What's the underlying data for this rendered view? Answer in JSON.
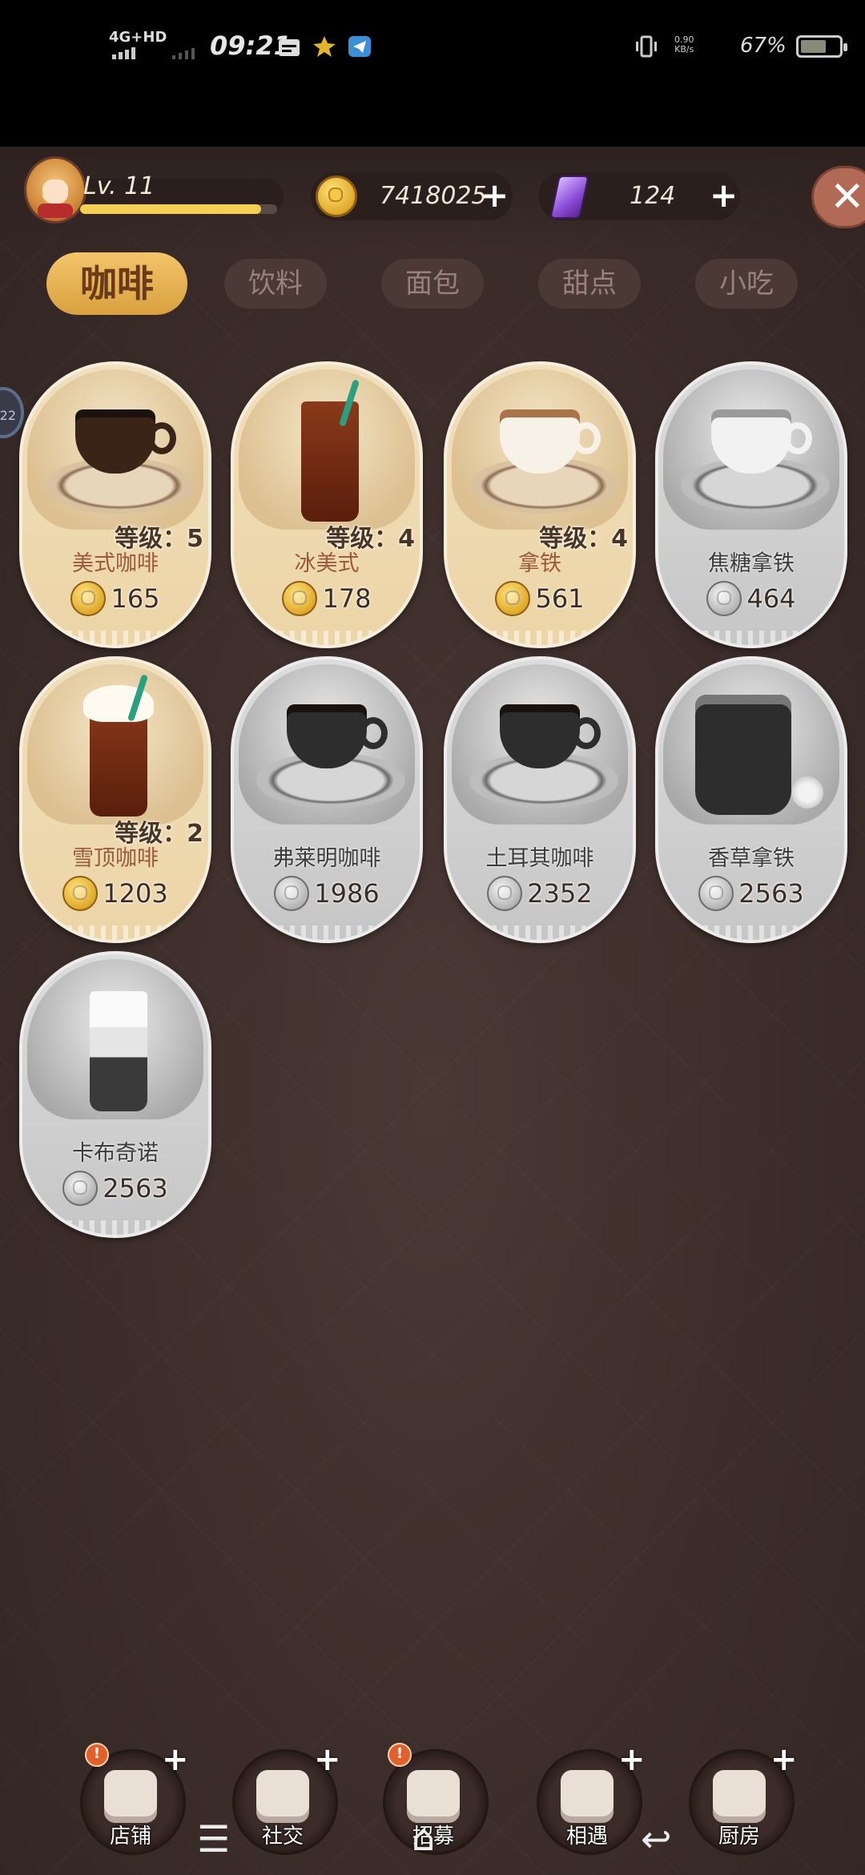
{
  "status_bar": {
    "network": "4G+HD",
    "time": "09:21",
    "net_speed_value": "0.90",
    "net_speed_unit": "KB/s",
    "battery": "67%",
    "battery_level": 0.67,
    "icons": [
      "calendar-icon",
      "star-icon",
      "telegram-icon",
      "vibrate-icon"
    ]
  },
  "hud": {
    "level_label": "Lv. 11",
    "level_progress": 0.92,
    "coins": "7418025",
    "gems": "124",
    "plus_symbol": "+",
    "close_symbol": "✕"
  },
  "tabs": [
    {
      "label": "咖啡",
      "active": true
    },
    {
      "label": "饮料",
      "active": false
    },
    {
      "label": "面包",
      "active": false
    },
    {
      "label": "甜点",
      "active": false
    },
    {
      "label": "小吃",
      "active": false
    }
  ],
  "side_indicator": "22",
  "items": [
    {
      "name": "美式咖啡",
      "level": "等级：5",
      "price": "165",
      "unlocked": true,
      "art": "black-coffee-cup"
    },
    {
      "name": "冰美式",
      "level": "等级：4",
      "price": "178",
      "unlocked": true,
      "art": "iced-americano-glass"
    },
    {
      "name": "拿铁",
      "level": "等级：4",
      "price": "561",
      "unlocked": true,
      "art": "latte-cup"
    },
    {
      "name": "焦糖拿铁",
      "level": "",
      "price": "464",
      "unlocked": false,
      "art": "caramel-latte-cup"
    },
    {
      "name": "雪顶咖啡",
      "level": "等级：2",
      "price": "1203",
      "unlocked": true,
      "art": "float-coffee-glass"
    },
    {
      "name": "弗莱明咖啡",
      "level": "",
      "price": "1986",
      "unlocked": false,
      "art": "flemish-coffee-cup"
    },
    {
      "name": "土耳其咖啡",
      "level": "",
      "price": "2352",
      "unlocked": false,
      "art": "turkish-coffee-cup"
    },
    {
      "name": "香草拿铁",
      "level": "",
      "price": "2563",
      "unlocked": false,
      "art": "vanilla-latte-mug"
    },
    {
      "name": "卡布奇诺",
      "level": "",
      "price": "2563",
      "unlocked": false,
      "art": "cappuccino-glass"
    }
  ],
  "bottom_nav": [
    {
      "label": "店铺",
      "icon": "shop-icon",
      "badge": "!",
      "plus": "+"
    },
    {
      "label": "社交",
      "icon": "coffee-social-icon",
      "badge": "",
      "plus": "+"
    },
    {
      "label": "招募",
      "icon": "recruit-door-icon",
      "badge": "!",
      "plus": ""
    },
    {
      "label": "相遇",
      "icon": "handshake-icon",
      "badge": "",
      "plus": "+"
    },
    {
      "label": "厨房",
      "icon": "kitchen-pan-icon",
      "badge": "",
      "plus": "+"
    }
  ],
  "system_nav": {
    "menu": "☰",
    "home": "⌂",
    "back": "↩"
  }
}
